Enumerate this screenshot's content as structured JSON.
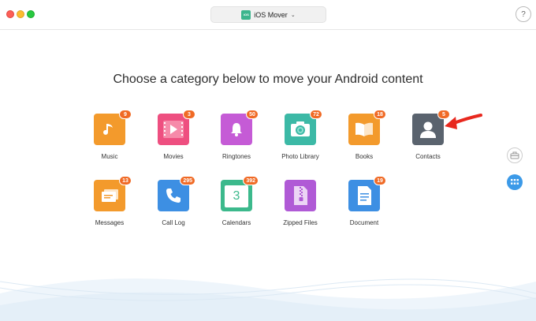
{
  "window": {
    "device_name": "iOS Mover",
    "device_badge": "iOS",
    "help_label": "?"
  },
  "heading": "Choose a category below to move your Android content",
  "categories": [
    {
      "label": "Music",
      "count": "9",
      "color": "#f39a2c",
      "icon": "music-note-icon"
    },
    {
      "label": "Movies",
      "count": "3",
      "color": "#ee4f80",
      "icon": "play-icon"
    },
    {
      "label": "Ringtones",
      "count": "50",
      "color": "#c55bd6",
      "icon": "bell-icon"
    },
    {
      "label": "Photo Library",
      "count": "72",
      "color": "#3cb9a6",
      "icon": "camera-icon"
    },
    {
      "label": "Books",
      "count": "18",
      "color": "#f39a2c",
      "icon": "book-icon"
    },
    {
      "label": "Contacts",
      "count": "5",
      "color": "#5a636e",
      "icon": "person-icon"
    },
    {
      "label": "Messages",
      "count": "13",
      "color": "#f39a2c",
      "icon": "message-icon"
    },
    {
      "label": "Call Log",
      "count": "295",
      "color": "#3d8fe3",
      "icon": "phone-icon"
    },
    {
      "label": "Calendars",
      "count": "392",
      "color": "#3cb98c",
      "icon": "calendar-icon"
    },
    {
      "label": "Zipped Files",
      "count": "",
      "color": "#b05ad6",
      "icon": "zip-icon"
    },
    {
      "label": "Document",
      "count": "19",
      "color": "#3d8fe3",
      "icon": "document-icon"
    }
  ],
  "calendar_day": "3",
  "accent": "#3c9ae8",
  "badge_color": "#f06a25",
  "arrow_color": "#e8281e"
}
